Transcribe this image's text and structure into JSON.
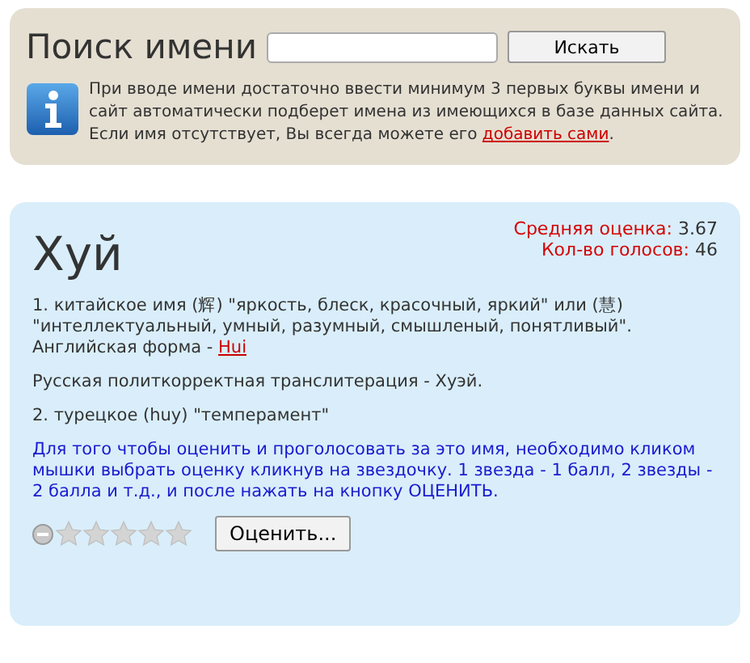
{
  "search": {
    "title": "Поиск имени",
    "button": "Искать",
    "info": "При вводе имени достаточно ввести минимум 3 первых буквы имени и сайт автоматически подберет имена из имеющихся в базе данных сайта. Если имя отсутствует, Вы всегда можете его ",
    "info_link": "добавить сами",
    "info_end": "."
  },
  "name_card": {
    "name": "Хуй",
    "stats": [
      {
        "label": "Средняя оценка:",
        "value": "3.67"
      },
      {
        "label": "Кол-во голосов:",
        "value": "46"
      }
    ],
    "meaning_1": "1. китайское имя (辉) \"яркость, блеск, красочный, яркий\" или (慧) \"интеллектуальный, умный, разумный, смышленый, понятливый\". Английская форма - ",
    "meaning_1_link": "Hui",
    "transliteration": "Русская политкорректная транслитерация - Хуэй.",
    "meaning_2": "2. турецкое (huy) \"темперамент\"",
    "vote_hint": "Для того чтобы оценить и проголосовать за это имя, необходимо кликом мышки выбрать оценку кликнув на звездочку. 1 звезда - 1 балл, 2 звезды - 2 балла и т.д., и после нажать на кнопку ОЦЕНИТЬ.",
    "rating": {
      "stars": 0
    },
    "rate_button": "Оценить..."
  }
}
